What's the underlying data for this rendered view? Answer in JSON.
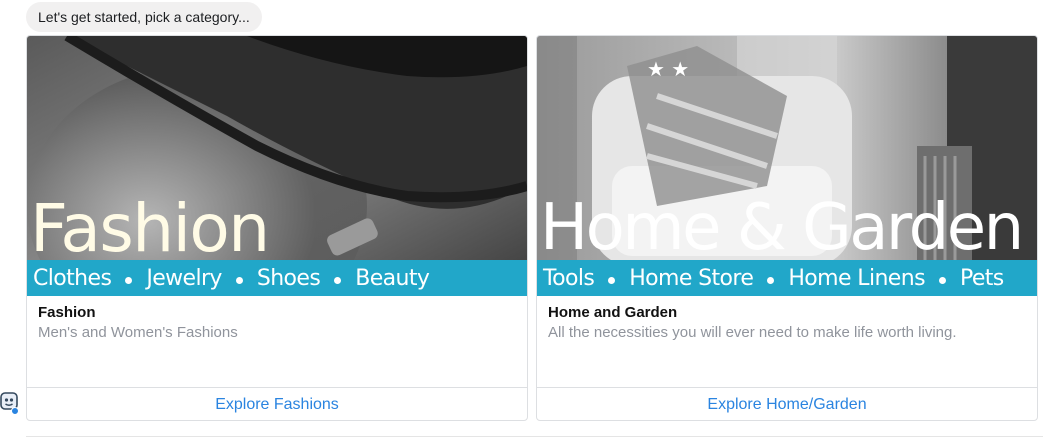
{
  "message": {
    "text": "Let's get started, pick a category..."
  },
  "cards": [
    {
      "hero_title": "Fashion",
      "subcategories": [
        "Clothes",
        "Jewelry",
        "Shoes",
        "Beauty"
      ],
      "title": "Fashion",
      "subtitle": "Men's and Women's Fashions",
      "action_label": "Explore Fashions"
    },
    {
      "hero_title": "Home & Garden",
      "subcategories": [
        "Tools",
        "Home Store",
        "Home Linens",
        "Pets"
      ],
      "title": "Home and Garden",
      "subtitle": "All the necessities you will ever need to make life worth living.",
      "action_label": "Explore Home/Garden"
    }
  ],
  "colors": {
    "accent_band": "#21a7c9",
    "link": "#2a84e0"
  },
  "icons": {
    "bot_avatar": "robot-avatar-icon"
  }
}
